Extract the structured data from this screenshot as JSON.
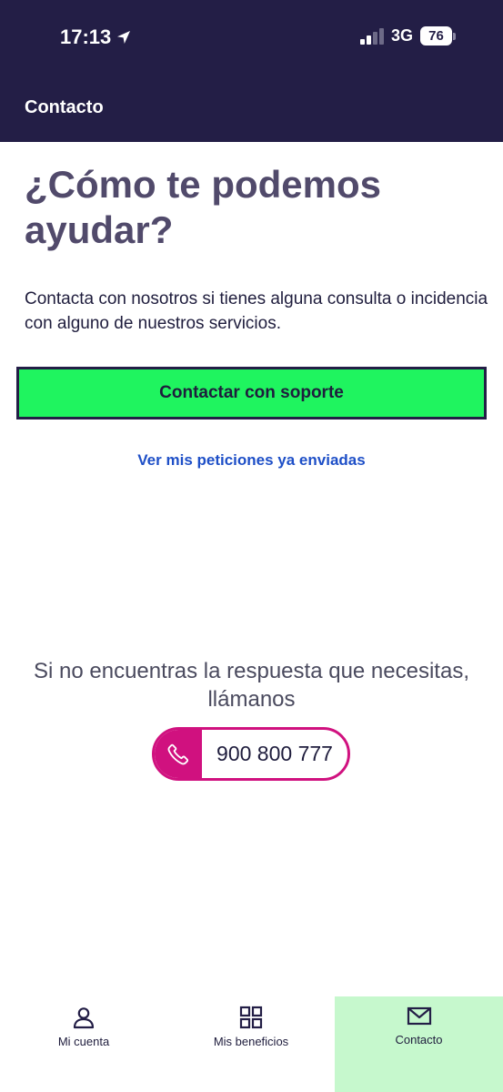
{
  "status_bar": {
    "time": "17:13",
    "network": "3G",
    "battery": "76"
  },
  "header": {
    "title": "Contacto"
  },
  "main": {
    "headline": "¿Cómo te podemos ayudar?",
    "intro": "Contacta con nosotros si tienes alguna consulta o incidencia con alguno de nuestros servicios.",
    "cta_label": "Contactar con soporte",
    "requests_link": "Ver mis peticiones ya enviadas",
    "call_text": "Si no encuentras la respuesta que necesitas, llámanos",
    "phone_number": "900 800 777"
  },
  "tabbar": {
    "items": [
      {
        "label": "Mi cuenta",
        "icon": "user-icon"
      },
      {
        "label": "Mis beneficios",
        "icon": "grid-icon"
      },
      {
        "label": "Contacto",
        "icon": "mail-icon",
        "active": true
      }
    ]
  },
  "colors": {
    "header_bg": "#231e46",
    "cta_bg": "#1ff45f",
    "link": "#1e4fc7",
    "phone_accent": "#d0117f",
    "active_tab_bg": "#c6f8cd"
  }
}
